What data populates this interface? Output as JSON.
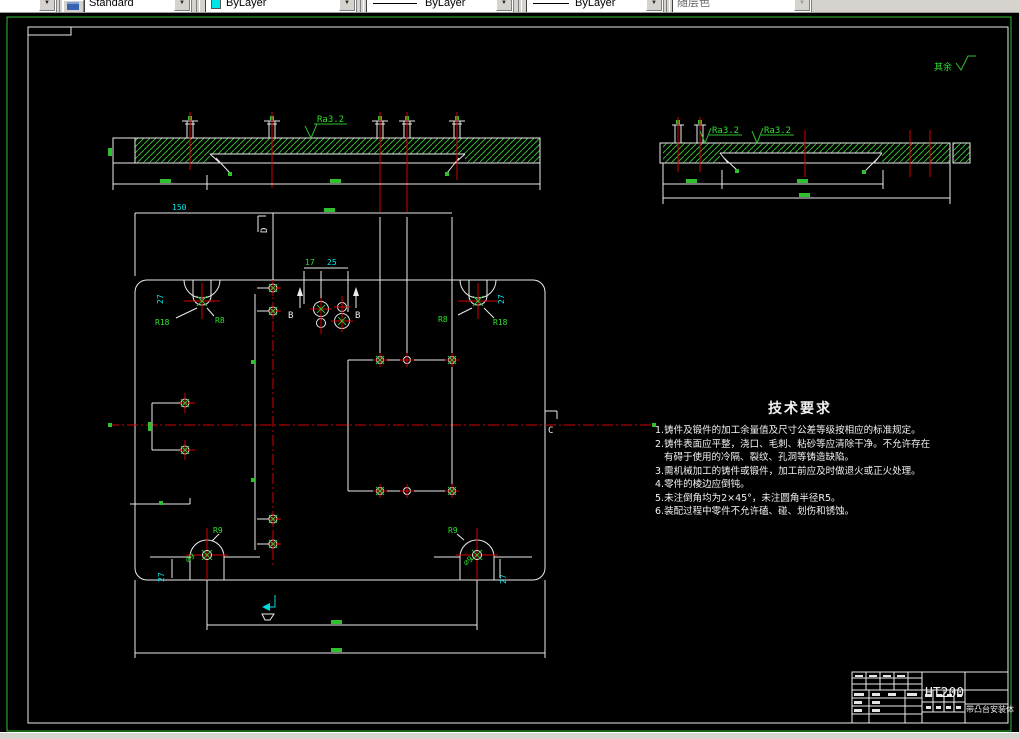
{
  "toolbar": {
    "style_combo": "Standard",
    "color_combo": "ByLayer",
    "linetype_combo": "ByLayer",
    "lineweight_combo": "ByLayer",
    "plotstyle_combo": "随层色",
    "dropdown_arrow": "▼"
  },
  "drawing": {
    "general_roughness_note": "其余",
    "roughness_label": "Ra3.2",
    "dims": {
      "d150": "150",
      "d17": "17",
      "d25": "25",
      "d27": "27"
    },
    "radii": {
      "r18": "R18",
      "r8": "R8",
      "r9": "R9"
    },
    "hole_label": "⌀9",
    "sections": {
      "b": "B",
      "c": "C",
      "d": "D"
    },
    "tech": {
      "title": "技术要求",
      "lines": [
        "1.铸件及锻件的加工余量值及尺寸公差等级按相应的标准规定。",
        "2.铸件表面应平整，浇口、毛刺、粘砂等应清除干净。不允许存在",
        "有碍于使用的冷隔、裂纹、孔洞等铸造缺陷。",
        "3.需机械加工的铸件或锻件，加工前应及时做退火或正火处理。",
        "4.零件的棱边应倒钝。",
        "5.未注倒角均为2×45°，未注圆角半径R5。",
        "6.装配过程中零件不允许磕、碰、划伤和锈蚀。"
      ]
    },
    "title_block": {
      "material": "HT200",
      "part_name": "带凸台安装体"
    }
  }
}
